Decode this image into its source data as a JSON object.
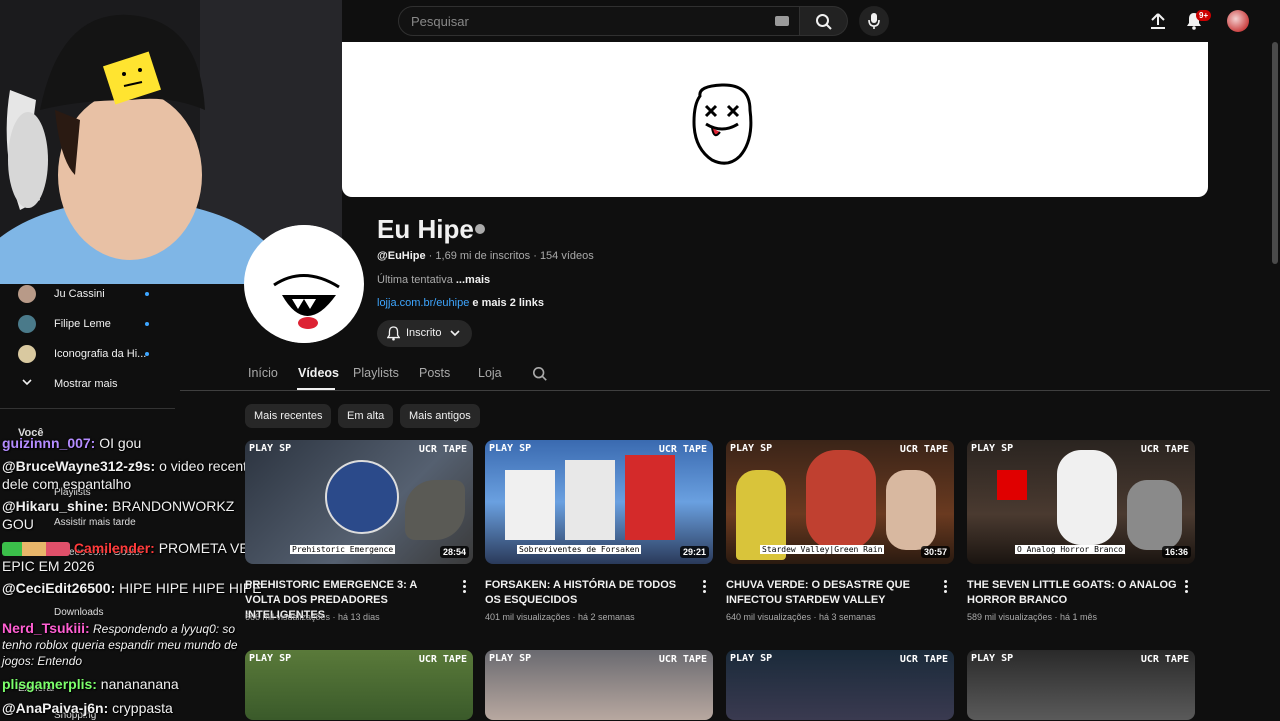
{
  "search": {
    "placeholder": "Pesquisar"
  },
  "header": {
    "notification_badge": "9+"
  },
  "channel": {
    "name": "Eu Hipe",
    "handle": "@EuHipe",
    "meta": " · 1,69 mi de inscritos · 154 vídeos",
    "description": "Última tentativa ",
    "description_more": "...mais",
    "link_url": "lojja.com.br/euhipe",
    "link_more": " e mais 2 links",
    "subscribe_label": "Inscrito"
  },
  "tabs": [
    {
      "label": "Início"
    },
    {
      "label": "Vídeos"
    },
    {
      "label": "Playlists"
    },
    {
      "label": "Posts"
    },
    {
      "label": "Loja"
    }
  ],
  "chips": [
    {
      "label": "Mais recentes"
    },
    {
      "label": "Em alta"
    },
    {
      "label": "Mais antigos"
    }
  ],
  "sidebar": {
    "subscriptions": [
      {
        "name": "Ju Cassini"
      },
      {
        "name": "Filipe Leme"
      },
      {
        "name": "Iconografia da Hi..."
      }
    ],
    "show_more": "Mostrar mais",
    "you_label": "Você",
    "ghost_items": [
      {
        "label": "Playlists"
      },
      {
        "label": "Assistir mais tarde"
      },
      {
        "label": "Vídeos com \"Gostei\""
      },
      {
        "label": "Downloads"
      },
      {
        "label": "Explorar"
      },
      {
        "label": "Shopping"
      }
    ]
  },
  "chat": [
    {
      "user": "guizinnn_007:",
      "text": " OI gou",
      "color": "#b48cff"
    },
    {
      "user": "@BruceWayne312-z9s:",
      "text": " o video recente dele com espantalho",
      "color": "#ffffff"
    },
    {
      "user": "@Hikaru_shine:",
      "text": " BRANDONWORKZ GOU",
      "color": "#ffffff"
    },
    {
      "user": "Camilender:",
      "text": " PROMETA VER EPIC EM 2026",
      "color": "#ff3b3b"
    },
    {
      "user": "@CeciEdit26500:",
      "text": " HIPE HIPE HIPE HIPE",
      "color": "#ffffff"
    },
    {
      "user": "Nerd_Tsukiii:",
      "text": " Respondendo a lyyuq0: so tenho roblox queria espandir meu mundo de jogos: Entendo",
      "color": "#ff5fd2"
    },
    {
      "user": "plisgamerplis:",
      "text": " nanananana",
      "color": "#7cff6b"
    },
    {
      "user": "@AnaPaiva-j6n:",
      "text": " cryppasta",
      "color": "#ffffff"
    }
  ],
  "videos": [
    {
      "vhs_left": "PLAY SP",
      "vhs_right": "UCR TAPE",
      "caption": "Prehistoric Emergence",
      "duration": "28:54",
      "title": "PREHISTORIC EMERGENCE 3: A VOLTA DOS PREDADORES INTELIGENTES",
      "meta": "666 mil visualizações · há 13 dias"
    },
    {
      "vhs_left": "PLAY SP",
      "vhs_right": "UCR TAPE",
      "caption": "Sobreviventes de Forsaken",
      "duration": "29:21",
      "title": "FORSAKEN: A HISTÓRIA DE TODOS OS ESQUECIDOS",
      "meta": "401 mil visualizações · há 2 semanas"
    },
    {
      "vhs_left": "PLAY SP",
      "vhs_right": "UCR TAPE",
      "caption": "Stardew Valley|Green Rain",
      "duration": "30:57",
      "title": "CHUVA VERDE: O DESASTRE QUE INFECTOU STARDEW VALLEY",
      "meta": "640 mil visualizações · há 3 semanas"
    },
    {
      "vhs_left": "PLAY SP",
      "vhs_right": "UCR TAPE",
      "caption": "O Analog Horror Branco",
      "duration": "16:36",
      "title": "THE SEVEN LITTLE GOATS: O ANALOG HORROR BRANCO",
      "meta": "589 mil visualizações · há 1 mês"
    }
  ],
  "videos_row2": [
    {
      "vhs_left": "PLAY SP",
      "vhs_right": "UCR TAPE"
    },
    {
      "vhs_left": "PLAY SP",
      "vhs_right": "UCR TAPE"
    },
    {
      "vhs_left": "PLAY SP",
      "vhs_right": "UCR TAPE"
    },
    {
      "vhs_left": "PLAY SP",
      "vhs_right": "UCR TAPE"
    }
  ],
  "colors": {
    "background": "#0f0f0f",
    "accent_link": "#3ea6ff",
    "badge_red": "#cc0000"
  }
}
